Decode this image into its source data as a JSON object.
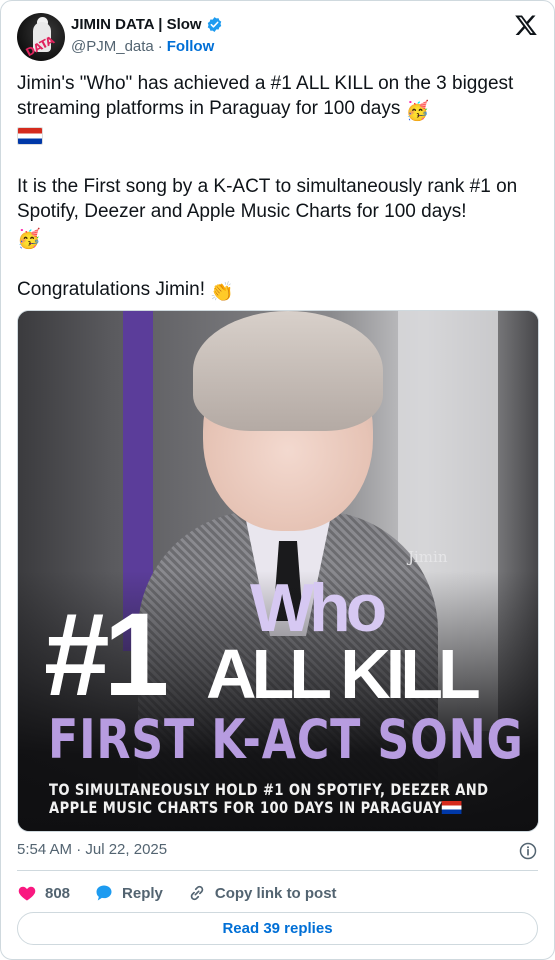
{
  "account": {
    "name": "JIMIN DATA | Slow",
    "handle": "@PJM_data",
    "separator": "·",
    "follow_label": "Follow",
    "avatar_text": "DATA",
    "verified_color": "#1d9bf0"
  },
  "tweet": {
    "paragraph1": "Jimin's \"Who\" has achieved a #1 ALL KILL on the 3 biggest streaming platforms in Paraguay for 100 days",
    "paragraph1_emoji": "🥳",
    "paragraph2": "It is the First song by a K-ACT to simultaneously rank #1 on Spotify, Deezer and Apple Music Charts for 100 days!",
    "paragraph2_emoji": "🥳",
    "paragraph3": "Congratulations Jimin!",
    "paragraph3_emoji": "👏"
  },
  "media": {
    "signature": "Jimin",
    "who": "Who",
    "rank": "#1",
    "headline": "ALL KILL",
    "subheadline": "FIRST K-ACT SONG",
    "caption_line1": "TO SIMULTANEOUSLY HOLD #1 ON SPOTIFY, DEEZER AND",
    "caption_line2": "APPLE MUSIC CHARTS FOR 100 DAYS IN PARAGUAY",
    "accent_color": "#b79ce0"
  },
  "meta": {
    "timestamp": "5:54 AM · Jul 22, 2025",
    "info_icon": "info-icon"
  },
  "actions": {
    "like_count": "808",
    "reply_label": "Reply",
    "copy_label": "Copy link to post",
    "read_replies_label": "Read 39 replies",
    "like_color": "#f91880",
    "reply_color": "#1d9bf0"
  }
}
